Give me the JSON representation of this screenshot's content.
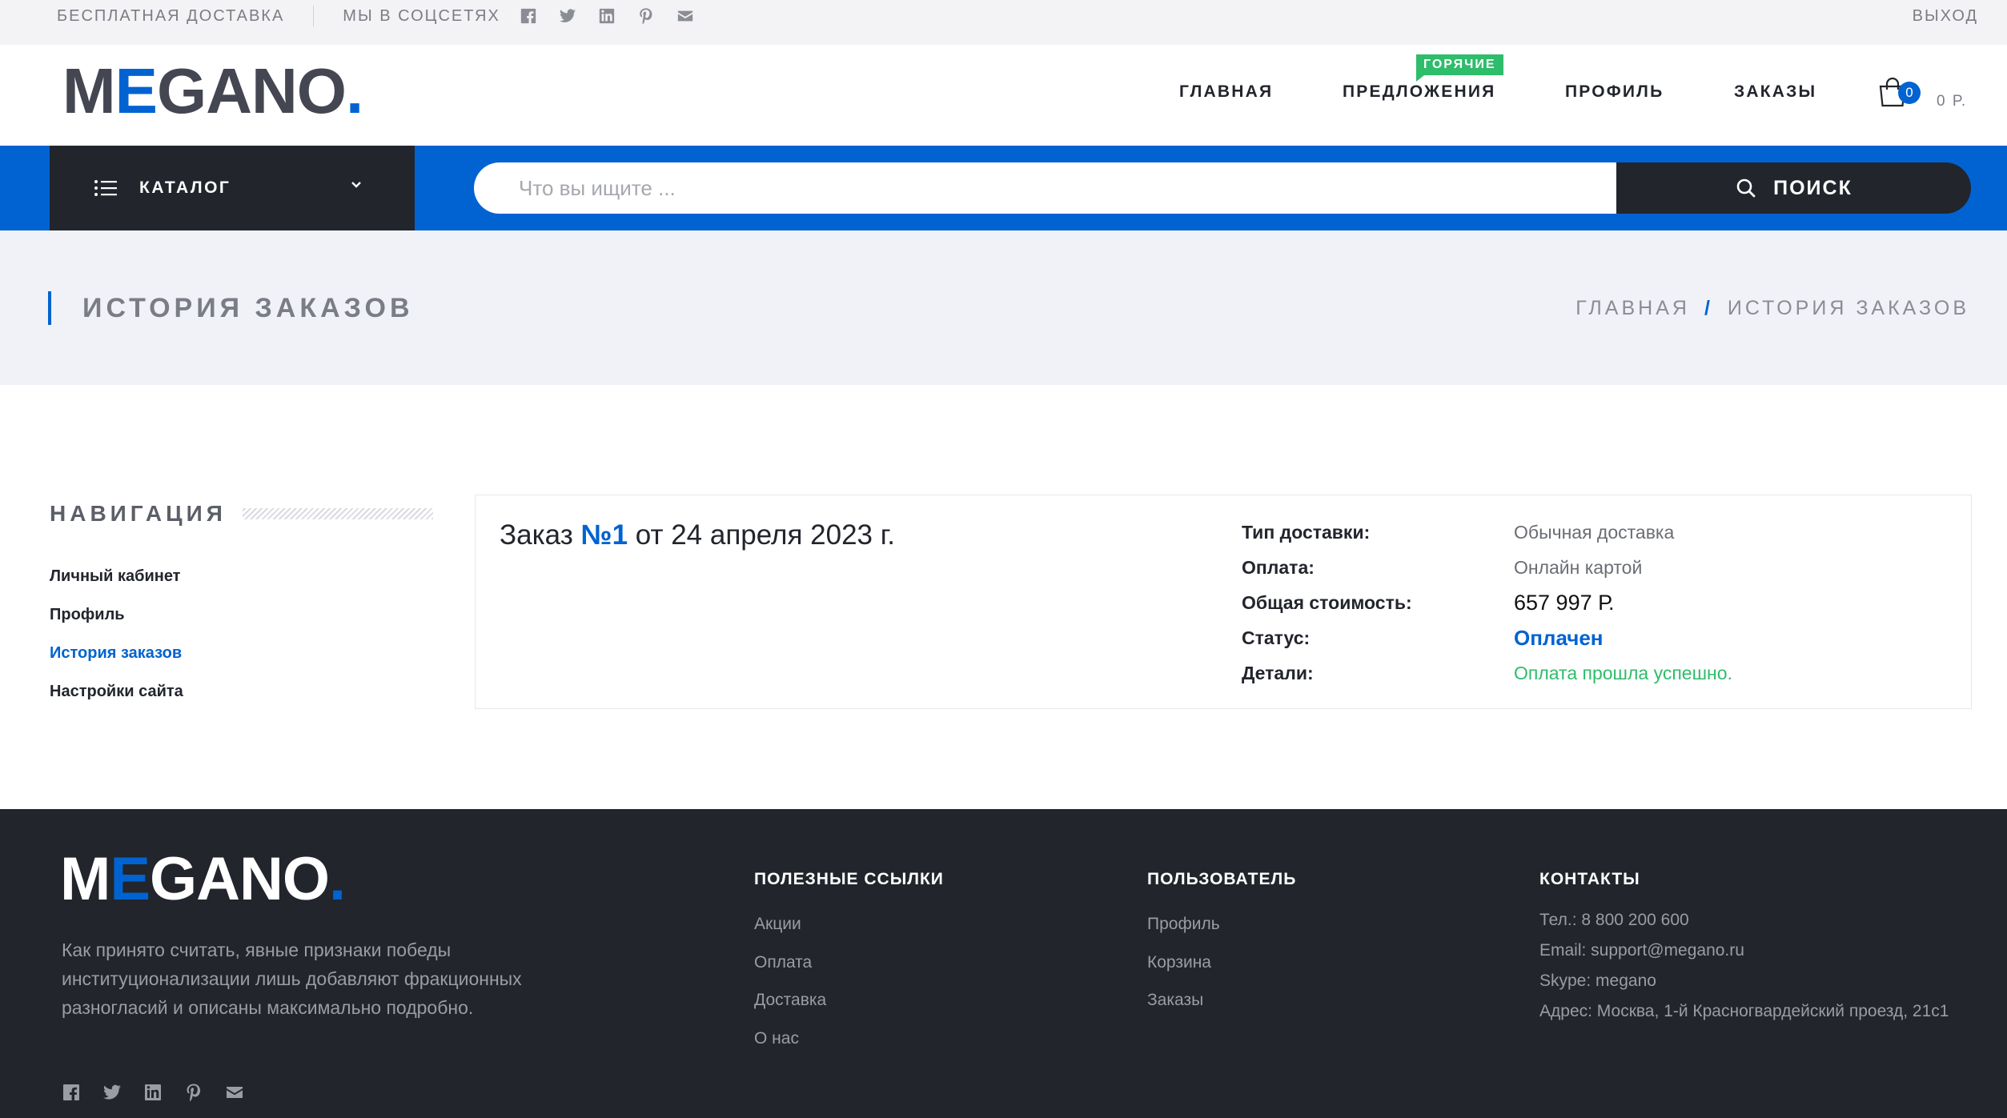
{
  "topbar": {
    "free_shipping": "БЕСПЛАТНАЯ ДОСТАВКА",
    "social_label": "МЫ В СОЦСЕТЯХ",
    "social_icons": [
      "facebook-icon",
      "twitter-icon",
      "linkedin-icon",
      "pinterest-icon",
      "mail-icon"
    ],
    "logout": "ВЫХОД"
  },
  "header": {
    "logo": {
      "m": "M",
      "e": "E",
      "rest": "GANO",
      "dot": "."
    },
    "nav": [
      {
        "label": "ГЛАВНАЯ"
      },
      {
        "label": "ПРЕДЛОЖЕНИЯ",
        "badge": "ГОРЯЧИЕ"
      },
      {
        "label": "ПРОФИЛЬ"
      },
      {
        "label": "ЗАКАЗЫ"
      }
    ],
    "cart": {
      "count": "0",
      "total": "0 Р."
    }
  },
  "searchbar": {
    "catalog_label": "КАТАЛОГ",
    "placeholder": "Что вы ищите ...",
    "button_label": "ПОИСК"
  },
  "page": {
    "title": "ИСТОРИЯ ЗАКАЗОВ",
    "breadcrumb": [
      "ГЛАВНАЯ",
      "/",
      "ИСТОРИЯ ЗАКАЗОВ"
    ]
  },
  "sidebar": {
    "heading": "НАВИГАЦИЯ",
    "items": [
      {
        "label": "Личный кабинет"
      },
      {
        "label": "Профиль"
      },
      {
        "label": "История заказов"
      },
      {
        "label": "Настройки сайта"
      }
    ]
  },
  "order": {
    "prefix": "Заказ",
    "number": "№1",
    "date": "от 24 апреля 2023 г.",
    "props": [
      {
        "label": "Тип доставки:",
        "value": "Обычная доставка"
      },
      {
        "label": "Оплата:",
        "value": "Онлайн картой"
      },
      {
        "label": "Общая стоимость:",
        "value": "657 997 Р."
      },
      {
        "label": "Статус:",
        "value": "Оплачен"
      },
      {
        "label": "Детали:",
        "value": "Оплата прошла успешно."
      }
    ]
  },
  "footer": {
    "about": "Как принято считать, явные признаки победы институционализации лишь добавляют фракционных разногласий и описаны максимально подробно.",
    "useful": {
      "heading": "ПОЛЕЗНЫЕ ССЫЛКИ",
      "links": [
        "Акции",
        "Оплата",
        "Доставка",
        "О нас"
      ]
    },
    "user": {
      "heading": "ПОЛЬЗОВАТЕЛЬ",
      "links": [
        "Профиль",
        "Корзина",
        "Заказы"
      ]
    },
    "contacts": {
      "heading": "КОНТАКТЫ",
      "lines": [
        "Тел.: 8 800 200 600",
        "Email: support@megano.ru",
        "Skype: megano",
        "Адрес: Москва, 1-й Красногвардейский проезд, 21с1"
      ]
    }
  },
  "colors": {
    "accent": "#0063d1",
    "dark": "#22252c",
    "success": "#2ebd6b",
    "page_bg": "#f0f2f7"
  }
}
